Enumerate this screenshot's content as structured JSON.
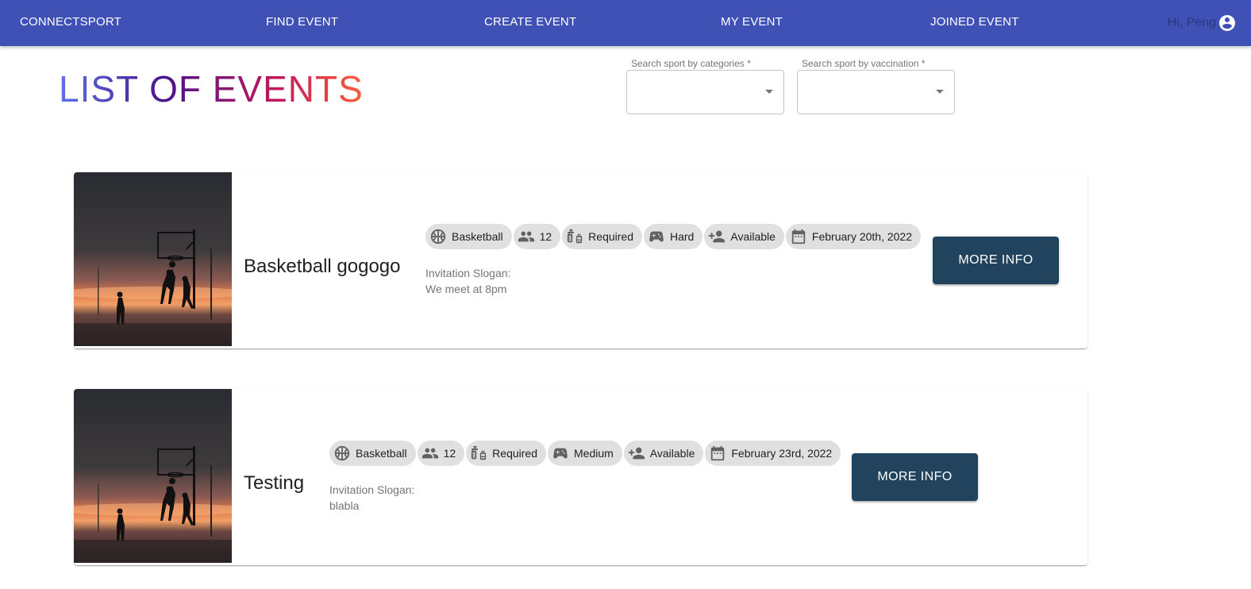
{
  "nav": {
    "brand": "CONNECTSPORT",
    "items": [
      "FIND EVENT",
      "CREATE EVENT",
      "MY EVENT",
      "JOINED EVENT"
    ],
    "greeting": "Hi, Peng",
    "account_icon": "account-circle-icon"
  },
  "page": {
    "title": "LIST OF EVENTS"
  },
  "filters": {
    "category": {
      "label": "Search sport by categories *",
      "value": ""
    },
    "vaccination": {
      "label": "Search sport by vaccination *",
      "value": ""
    }
  },
  "events": [
    {
      "title": "Basketball gogogo",
      "chips": {
        "sport": "Basketball",
        "participants": "12",
        "vaccination": "Required",
        "difficulty": "Hard",
        "availability": "Available",
        "date": "February 20th, 2022"
      },
      "slogan_label": "Invitation Slogan:",
      "slogan": "We meet at 8pm",
      "button": "MORE INFO"
    },
    {
      "title": "Testing",
      "chips": {
        "sport": "Basketball",
        "participants": "12",
        "vaccination": "Required",
        "difficulty": "Medium",
        "availability": "Available",
        "date": "February 23rd, 2022"
      },
      "slogan_label": "Invitation Slogan:",
      "slogan": "blabla",
      "button": "MORE INFO"
    }
  ],
  "colors": {
    "appbar": "#3f51b5",
    "button": "#22435e",
    "chip": "#e0e0e0"
  }
}
